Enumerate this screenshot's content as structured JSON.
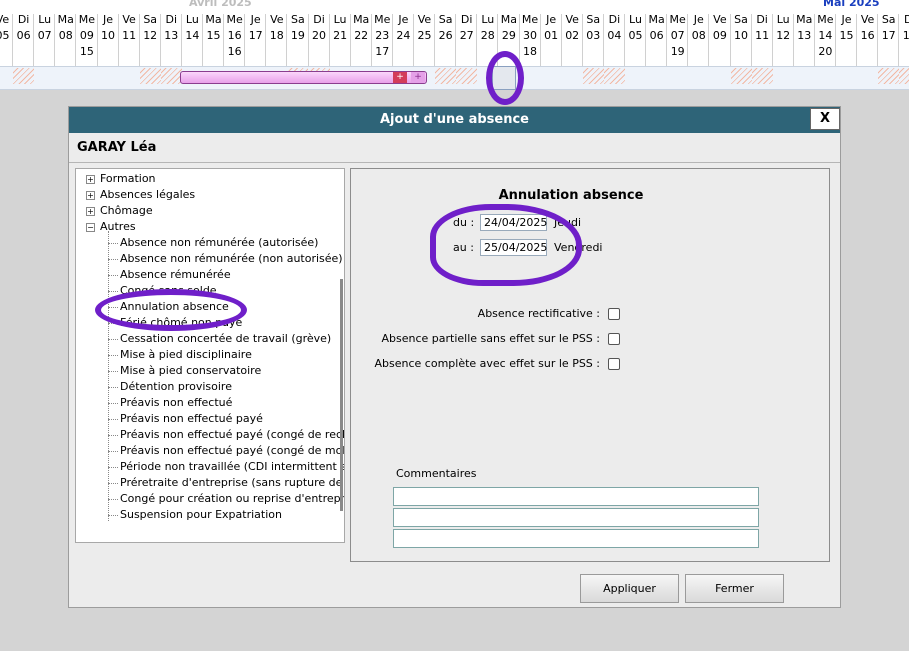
{
  "calendar": {
    "month_april": "Avril 2025",
    "month_may": "Mai 2025",
    "days": [
      {
        "name": "Ve",
        "num": "05",
        "week": ""
      },
      {
        "name": "Di",
        "num": "06",
        "week": ""
      },
      {
        "name": "Lu",
        "num": "07",
        "week": ""
      },
      {
        "name": "Ma",
        "num": "08",
        "week": ""
      },
      {
        "name": "Me",
        "num": "09",
        "week": "15"
      },
      {
        "name": "Je",
        "num": "10",
        "week": ""
      },
      {
        "name": "Ve",
        "num": "11",
        "week": ""
      },
      {
        "name": "Sa",
        "num": "12",
        "week": ""
      },
      {
        "name": "Di",
        "num": "13",
        "week": ""
      },
      {
        "name": "Lu",
        "num": "14",
        "week": ""
      },
      {
        "name": "Ma",
        "num": "15",
        "week": ""
      },
      {
        "name": "Me",
        "num": "16",
        "week": "16"
      },
      {
        "name": "Je",
        "num": "17",
        "week": ""
      },
      {
        "name": "Ve",
        "num": "18",
        "week": ""
      },
      {
        "name": "Sa",
        "num": "19",
        "week": ""
      },
      {
        "name": "Di",
        "num": "20",
        "week": ""
      },
      {
        "name": "Lu",
        "num": "21",
        "week": ""
      },
      {
        "name": "Ma",
        "num": "22",
        "week": ""
      },
      {
        "name": "Me",
        "num": "23",
        "week": "17"
      },
      {
        "name": "Je",
        "num": "24",
        "week": ""
      },
      {
        "name": "Ve",
        "num": "25",
        "week": ""
      },
      {
        "name": "Sa",
        "num": "26",
        "week": ""
      },
      {
        "name": "Di",
        "num": "27",
        "week": ""
      },
      {
        "name": "Lu",
        "num": "28",
        "week": ""
      },
      {
        "name": "Ma",
        "num": "29",
        "week": ""
      },
      {
        "name": "Me",
        "num": "30",
        "week": "18"
      },
      {
        "name": "Je",
        "num": "01",
        "week": ""
      },
      {
        "name": "Ve",
        "num": "02",
        "week": ""
      },
      {
        "name": "Sa",
        "num": "03",
        "week": ""
      },
      {
        "name": "Di",
        "num": "04",
        "week": ""
      },
      {
        "name": "Lu",
        "num": "05",
        "week": ""
      },
      {
        "name": "Ma",
        "num": "06",
        "week": ""
      },
      {
        "name": "Me",
        "num": "07",
        "week": "19"
      },
      {
        "name": "Je",
        "num": "08",
        "week": ""
      },
      {
        "name": "Ve",
        "num": "09",
        "week": ""
      },
      {
        "name": "Sa",
        "num": "10",
        "week": ""
      },
      {
        "name": "Di",
        "num": "11",
        "week": ""
      },
      {
        "name": "Lu",
        "num": "12",
        "week": ""
      },
      {
        "name": "Ma",
        "num": "13",
        "week": ""
      },
      {
        "name": "Me",
        "num": "14",
        "week": "20"
      },
      {
        "name": "Je",
        "num": "15",
        "week": ""
      },
      {
        "name": "Ve",
        "num": "16",
        "week": ""
      },
      {
        "name": "Sa",
        "num": "17",
        "week": ""
      },
      {
        "name": "Di",
        "num": "18",
        "week": ""
      }
    ],
    "bar_plus_1": "+",
    "bar_plus_2": "+"
  },
  "dialog": {
    "title": "Ajout d'une absence",
    "close_label": "X",
    "person_name": "GARAY Léa",
    "tree": [
      {
        "label": "Formation",
        "level": 0,
        "expander": "+"
      },
      {
        "label": "Absences légales",
        "level": 0,
        "expander": "+"
      },
      {
        "label": "Chômage",
        "level": 0,
        "expander": "+"
      },
      {
        "label": "Autres",
        "level": 0,
        "expander": "−"
      },
      {
        "label": "Absence non rémunérée (autorisée)",
        "level": 1,
        "expander": ""
      },
      {
        "label": "Absence non rémunérée (non autorisée)",
        "level": 1,
        "expander": ""
      },
      {
        "label": "Absence rémunérée",
        "level": 1,
        "expander": ""
      },
      {
        "label": "Congé sans solde",
        "level": 1,
        "expander": ""
      },
      {
        "label": "Annulation absence",
        "level": 1,
        "expander": ""
      },
      {
        "label": "Férié chômé non payé",
        "level": 1,
        "expander": ""
      },
      {
        "label": "Cessation concertée de travail (grève)",
        "level": 1,
        "expander": ""
      },
      {
        "label": "Mise à pied disciplinaire",
        "level": 1,
        "expander": ""
      },
      {
        "label": "Mise à pied conservatoire",
        "level": 1,
        "expander": ""
      },
      {
        "label": "Détention provisoire",
        "level": 1,
        "expander": ""
      },
      {
        "label": "Préavis non effectué",
        "level": 1,
        "expander": ""
      },
      {
        "label": "Préavis non effectué payé",
        "level": 1,
        "expander": ""
      },
      {
        "label": "Préavis non effectué payé (congé de reclas",
        "level": 1,
        "expander": ""
      },
      {
        "label": "Préavis non effectué payé (congé de mobili",
        "level": 1,
        "expander": ""
      },
      {
        "label": "Période non travaillée (CDI intermittent san",
        "level": 1,
        "expander": ""
      },
      {
        "label": "Préretraite d'entreprise (sans rupture de cc",
        "level": 1,
        "expander": ""
      },
      {
        "label": "Congé pour création ou reprise d'entreprise",
        "level": 1,
        "expander": ""
      },
      {
        "label": "Suspension pour Expatriation",
        "level": 1,
        "expander": ""
      }
    ],
    "panel": {
      "title": "Annulation absence",
      "from_label": "du :",
      "from_value": "24/04/2025",
      "from_day": "Jeudi",
      "to_label": "au :",
      "to_value": "25/04/2025",
      "to_day": "Vendredi",
      "check_rectificative": "Absence rectificative :",
      "check_partielle": "Absence partielle sans effet sur le PSS :",
      "check_complete": "Absence complète avec effet sur le PSS :",
      "comments_label": "Commentaires"
    },
    "buttons": {
      "apply": "Appliquer",
      "close": "Fermer"
    }
  },
  "colors": {
    "titlebar": "#2e6478",
    "annotation": "#6f1fc9",
    "bar": "#e8a1ea"
  }
}
